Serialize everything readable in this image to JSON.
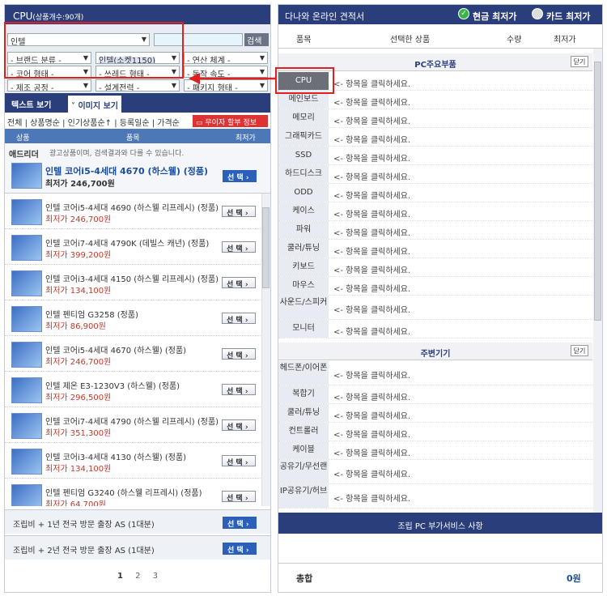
{
  "left": {
    "title": "CPU",
    "count": "(상품개수:90개)",
    "maker": "인텔",
    "search_btn": "검색",
    "filters": [
      "- 브랜드 분류 -",
      "인텔(소켓1150)",
      "- 연산 체계 -",
      "- 코어 형태 -",
      "- 쓰레드 형태 -",
      "- 동작 속도 -",
      "- 제조 공정 -",
      "- 설계전력 -",
      "- 패키지 형태 -"
    ],
    "tab_text": "텍스트 보기",
    "tab_image": "˅ 이미지 보기",
    "sort": "전체 | 상품명순 | 인기상품순↑ | 등록일순 | 가격순",
    "no_interest": "무이자 할부 정보",
    "th": [
      "상품",
      "품목",
      "최저가"
    ],
    "ad_label": "애드리더",
    "ad_notice": "광고상품이며, 검색결과와 다를 수 있습니다.",
    "ad_name": "인텔 코어i5-4세대 4670 (하스웰) (정품)",
    "ad_price": "최저가 246,700원",
    "select_btn": "선 택 ›",
    "products": [
      {
        "name": "인텔 코어i5-4세대 4690 (하스웰 리프레시) (정품)",
        "price": "최저가 246,700원"
      },
      {
        "name": "인텔 코어i7-4세대 4790K (데빌스 캐년) (정품)",
        "price": "최저가 399,200원"
      },
      {
        "name": "인텔 코어i3-4세대 4150 (하스웰 리프레시) (정품)",
        "price": "최저가 134,100원"
      },
      {
        "name": "인텔 펜티엄 G3258 (정품)",
        "price": "최저가 86,900원"
      },
      {
        "name": "인텔 코어i5-4세대 4670 (하스웰) (정품)",
        "price": "최저가 246,700원"
      },
      {
        "name": "인텔 제온 E3-1230V3 (하스웰) (정품)",
        "price": "최저가 296,500원"
      },
      {
        "name": "인텔 코어i7-4세대 4790 (하스웰 리프레시) (정품)",
        "price": "최저가 351,300원"
      },
      {
        "name": "인텔 코어i3-4세대 4130 (하스웰) (정품)",
        "price": "최저가 134,100원"
      },
      {
        "name": "인텔 펜티엄 G3240 (하스웰 리프레시) (정품)",
        "price": "최저가 64,700원"
      }
    ],
    "services": [
      "조립비 + 1년 전국 방문 출장 AS (1대분)",
      "조립비 + 2년 전국 방문 출장 AS (1대분)"
    ],
    "pages": [
      "1",
      "2",
      "3"
    ]
  },
  "right": {
    "title": "다나와 온라인 견적서",
    "cash": "현금 최저가",
    "card": "카드 최저가",
    "cols": [
      "품목",
      "선택한 상품",
      "수량",
      "최저가"
    ],
    "section1": "PC주요부품",
    "section2": "주변기기",
    "close": "닫기",
    "hint": "<- 항목을 클릭하세요.",
    "main_parts": [
      "CPU",
      "메인보드",
      "메모리",
      "그래픽카드",
      "SSD",
      "하드디스크",
      "ODD",
      "케이스",
      "파워",
      "쿨러/튜닝",
      "키보드",
      "마우스",
      "사운드/스피커",
      "모니터"
    ],
    "peripherals": [
      "헤드폰/이어폰",
      "복합기",
      "쿨러/튜닝",
      "컨트롤러",
      "케이블",
      "공유기/무선랜",
      "IP공유기/허브"
    ],
    "service_title": "조립 PC 부가서비스 사항",
    "total_label": "총합",
    "total_value": "0원"
  }
}
